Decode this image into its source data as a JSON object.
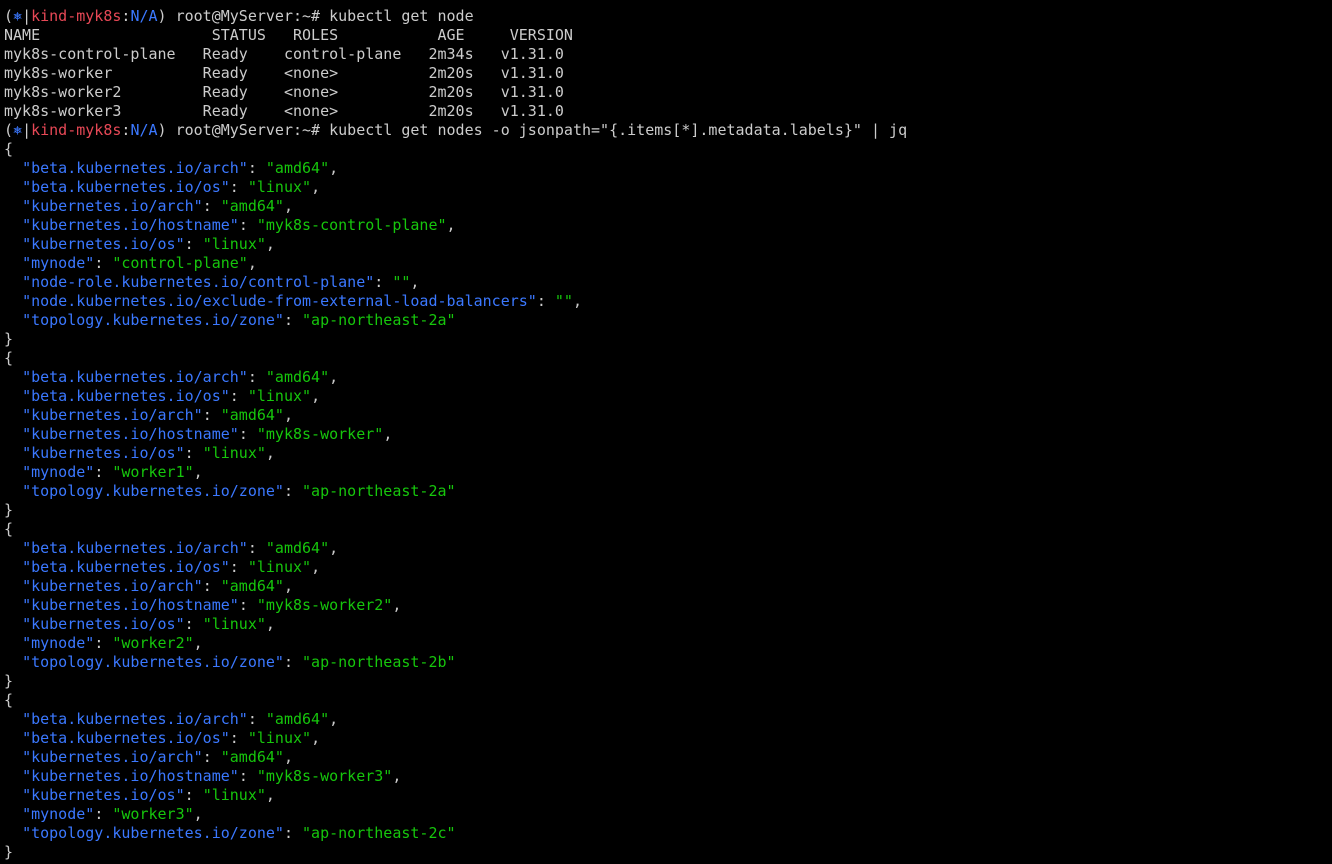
{
  "colors": {
    "background": "#000000",
    "foreground": "#cccccc",
    "context": "#e74856",
    "namespace": "#3b78ff",
    "json_key": "#3b78ff",
    "json_string": "#16c60c"
  },
  "prompt": {
    "icon": "⎈",
    "icon_name": "kubernetes-helm-icon",
    "open": "(",
    "separator": "|",
    "context": "kind-myk8s",
    "colon": ":",
    "namespace": "N/A",
    "close": ")",
    "user_host": " root@MyServer:~# "
  },
  "commands": [
    "kubectl get node",
    "kubectl get nodes -o jsonpath=\"{.items[*].metadata.labels}\" | jq"
  ],
  "node_table": {
    "header": "NAME                   STATUS   ROLES           AGE     VERSION",
    "rows": [
      "myk8s-control-plane   Ready    control-plane   2m34s   v1.31.0",
      "myk8s-worker          Ready    <none>          2m20s   v1.31.0",
      "myk8s-worker2         Ready    <none>          2m20s   v1.31.0",
      "myk8s-worker3         Ready    <none>          2m20s   v1.31.0"
    ]
  },
  "label_objects": [
    [
      {
        "key": "beta.kubernetes.io/arch",
        "value": "amd64"
      },
      {
        "key": "beta.kubernetes.io/os",
        "value": "linux"
      },
      {
        "key": "kubernetes.io/arch",
        "value": "amd64"
      },
      {
        "key": "kubernetes.io/hostname",
        "value": "myk8s-control-plane"
      },
      {
        "key": "kubernetes.io/os",
        "value": "linux"
      },
      {
        "key": "mynode",
        "value": "control-plane"
      },
      {
        "key": "node-role.kubernetes.io/control-plane",
        "value": ""
      },
      {
        "key": "node.kubernetes.io/exclude-from-external-load-balancers",
        "value": ""
      },
      {
        "key": "topology.kubernetes.io/zone",
        "value": "ap-northeast-2a"
      }
    ],
    [
      {
        "key": "beta.kubernetes.io/arch",
        "value": "amd64"
      },
      {
        "key": "beta.kubernetes.io/os",
        "value": "linux"
      },
      {
        "key": "kubernetes.io/arch",
        "value": "amd64"
      },
      {
        "key": "kubernetes.io/hostname",
        "value": "myk8s-worker"
      },
      {
        "key": "kubernetes.io/os",
        "value": "linux"
      },
      {
        "key": "mynode",
        "value": "worker1"
      },
      {
        "key": "topology.kubernetes.io/zone",
        "value": "ap-northeast-2a"
      }
    ],
    [
      {
        "key": "beta.kubernetes.io/arch",
        "value": "amd64"
      },
      {
        "key": "beta.kubernetes.io/os",
        "value": "linux"
      },
      {
        "key": "kubernetes.io/arch",
        "value": "amd64"
      },
      {
        "key": "kubernetes.io/hostname",
        "value": "myk8s-worker2"
      },
      {
        "key": "kubernetes.io/os",
        "value": "linux"
      },
      {
        "key": "mynode",
        "value": "worker2"
      },
      {
        "key": "topology.kubernetes.io/zone",
        "value": "ap-northeast-2b"
      }
    ],
    [
      {
        "key": "beta.kubernetes.io/arch",
        "value": "amd64"
      },
      {
        "key": "beta.kubernetes.io/os",
        "value": "linux"
      },
      {
        "key": "kubernetes.io/arch",
        "value": "amd64"
      },
      {
        "key": "kubernetes.io/hostname",
        "value": "myk8s-worker3"
      },
      {
        "key": "kubernetes.io/os",
        "value": "linux"
      },
      {
        "key": "mynode",
        "value": "worker3"
      },
      {
        "key": "topology.kubernetes.io/zone",
        "value": "ap-northeast-2c"
      }
    ]
  ]
}
